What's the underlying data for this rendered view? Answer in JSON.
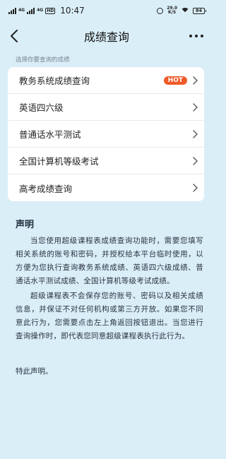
{
  "status_bar": {
    "network_1": "4G",
    "network_2": "4G",
    "hd": "HD",
    "time": "10:47",
    "speed_value": "29.0",
    "speed_unit": "K/S",
    "battery": "84"
  },
  "nav": {
    "title": "成绩查询",
    "back_icon": "chevron-left-icon",
    "more_icon": "more-horizontal-icon"
  },
  "hint": "选择你要查询的成绩",
  "menu": [
    {
      "label": "教务系统成绩查询",
      "badge": "HOT"
    },
    {
      "label": "英语四六级",
      "badge": ""
    },
    {
      "label": "普通话水平测试",
      "badge": ""
    },
    {
      "label": "全国计算机等级考试",
      "badge": ""
    },
    {
      "label": "高考成绩查询",
      "badge": ""
    }
  ],
  "statement": {
    "title": "声明",
    "paragraph_1": "当您使用超级课程表成绩查询功能时，需要您填写相关系统的账号和密码，并授权给本平台临时使用，以方便为您执行查询教务系统成绩、英语四六级成绩、普通话水平测试成绩、全国计算机等级考试成绩。",
    "paragraph_2": "超级课程表不会保存您的账号、密码以及相关成绩信息，并保证不对任何机构或第三方开放。如果您不同意此行为，您需要点击左上角返回按钮退出。当您进行查询操作时，即代表您同意超级课程表执行此行为。",
    "closing": "特此声明。"
  },
  "colors": {
    "background": "#daeef8",
    "hot_badge": "#f05a28",
    "card": "#ffffff"
  }
}
